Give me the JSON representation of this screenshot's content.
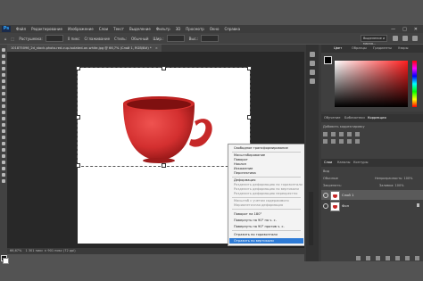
{
  "app": {
    "logo": "Ps",
    "menu": [
      "Файл",
      "Редактирование",
      "Изображение",
      "Слои",
      "Текст",
      "Выделение",
      "Фильтр",
      "3D",
      "Просмотр",
      "Окно",
      "Справка"
    ],
    "window_buttons": [
      "—",
      "□",
      "✕"
    ]
  },
  "options_bar": {
    "labels": [
      "Растушевка:",
      "0 пикс",
      "Сглаживание",
      "Стиль:",
      "Обычный",
      "Шир.:",
      "Выс.:"
    ],
    "select_mask": "Выделение и маска..."
  },
  "document": {
    "tab_title": "101875096_2d_stock-photo-red-cup-isolated-on-white.jpg @ 66,7% (Слой 1, RGB/8#) *",
    "close_glyph": "×"
  },
  "context_menu": {
    "items": [
      {
        "label": "Свободное трансформирование",
        "dim": false
      },
      {
        "label": "Масштабирование",
        "dim": false
      },
      {
        "label": "Поворот",
        "dim": false
      },
      {
        "label": "Наклон",
        "dim": false
      },
      {
        "label": "Искажение",
        "dim": false
      },
      {
        "label": "Перспектива",
        "dim": false
      },
      {
        "label": "Деформация",
        "dim": false
      },
      {
        "label": "Разделить деформацию по горизонтали",
        "dim": true
      },
      {
        "label": "Разделить деформацию по вертикали",
        "dim": true
      },
      {
        "label": "Разделить деформацию перекрестно",
        "dim": true
      },
      {
        "label": "Масштаб с учетом содержимого",
        "dim": true
      },
      {
        "label": "Марионеточная деформация",
        "dim": true
      },
      {
        "label": "Поворот на 180°",
        "dim": false
      },
      {
        "label": "Повернуть на 90° по ч. с.",
        "dim": false
      },
      {
        "label": "Повернуть на 90° против ч. с.",
        "dim": false
      },
      {
        "label": "Отразить по горизонтали",
        "dim": false
      }
    ],
    "highlighted": "Отразить по вертикали"
  },
  "status_bar": {
    "zoom": "66,67%",
    "info": "1 301 пикс × 901 пикс (72 ppi)"
  },
  "right_panels": {
    "color_tabs": [
      "Цвет",
      "Образцы",
      "Градиенты",
      "Узоры"
    ],
    "adj_tabs": [
      "Обучение",
      "Библиотеки",
      "Коррекция"
    ],
    "adj_caption": "Добавить корректировку",
    "layers_tabs": [
      "Слои",
      "Каналы",
      "Контуры"
    ],
    "layers_kind": "Вид",
    "blend_mode": "Обычные",
    "opacity": "Непрозрачность: 100%",
    "lock_label": "Закрепить:",
    "fill": "Заливка: 100%",
    "layers": [
      {
        "name": "Слой 1",
        "selected": true
      },
      {
        "name": "Фон",
        "selected": false
      }
    ]
  },
  "colors": {
    "highlight": "#2e7bd6",
    "cup_red": "#d32f2f"
  }
}
